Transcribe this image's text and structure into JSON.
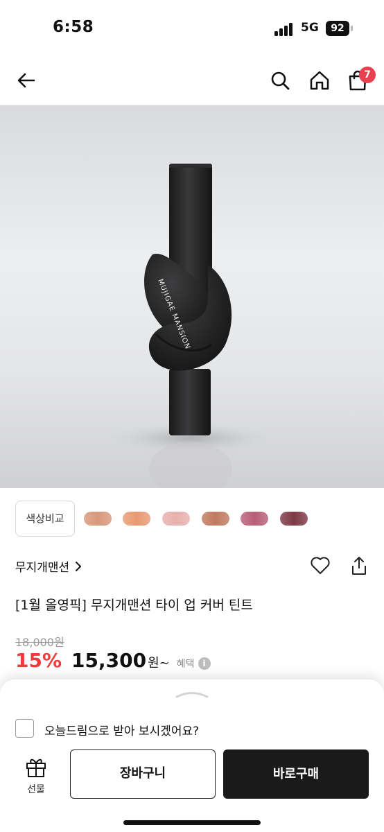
{
  "status_bar": {
    "time": "6:58",
    "network": "5G",
    "battery": "92"
  },
  "header": {
    "cart_count": "7"
  },
  "hero": {
    "logo_text": "MUJIGAE MANSION"
  },
  "swatches": {
    "compare_label": "색상비교",
    "colors": [
      "#d8987a",
      "#e89a72",
      "#e8b0ad",
      "#c07a60",
      "#b85d78",
      "#7d3a44"
    ]
  },
  "product": {
    "brand": "무지개맨션",
    "title": "[1월 올영픽] 무지개맨션 타이 업 커버 틴트",
    "original_price": "18,000원",
    "discount": "15%",
    "price": "15,300",
    "price_unit": "원~",
    "benefit_label": "혜택"
  },
  "bottom_sheet": {
    "dream_label": "오늘드림으로 받아 보시겠어요?",
    "gift_label": "선물",
    "cart_button": "장바구니",
    "buy_button": "바로구매"
  }
}
